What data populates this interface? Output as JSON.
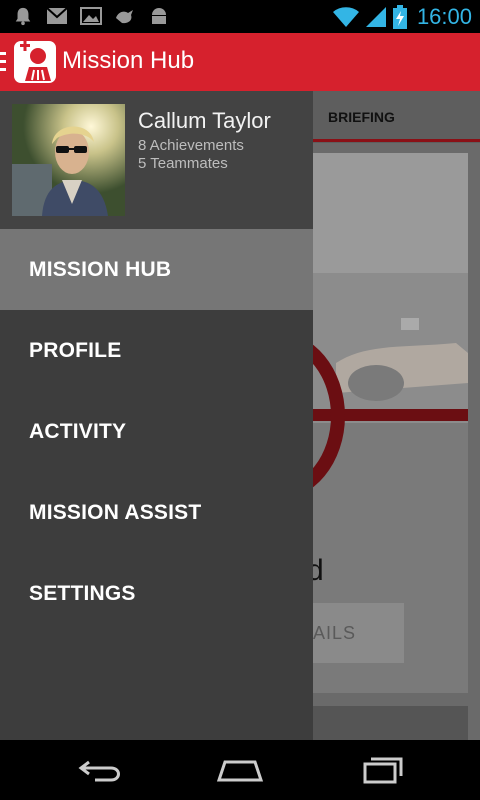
{
  "status_bar": {
    "time": "16:00",
    "left_icons": [
      "notification-bell-icon",
      "gmail-icon",
      "gallery-icon",
      "bird-icon",
      "android-icon"
    ],
    "right_icons": [
      "wifi-icon",
      "signal-icon",
      "battery-charging-icon"
    ],
    "accent_color": "#33b5e5"
  },
  "action_bar": {
    "title": "Mission Hub",
    "color": "#d6212d"
  },
  "drawer": {
    "profile": {
      "name": "Callum Taylor",
      "achievements": "8 Achievements",
      "teammates": "5 Teammates"
    },
    "items": [
      {
        "label": "MISSION HUB",
        "active": true
      },
      {
        "label": "PROFILE",
        "active": false
      },
      {
        "label": "ACTIVITY",
        "active": false
      },
      {
        "label": "MISSION ASSIST",
        "active": false
      },
      {
        "label": "SETTINGS",
        "active": false
      }
    ]
  },
  "background": {
    "tab_label": "BRIEFING",
    "partial_text": "d",
    "partial_button": "AILS"
  },
  "nav_bar": {
    "buttons": [
      "back-icon",
      "home-icon",
      "recent-apps-icon"
    ]
  }
}
